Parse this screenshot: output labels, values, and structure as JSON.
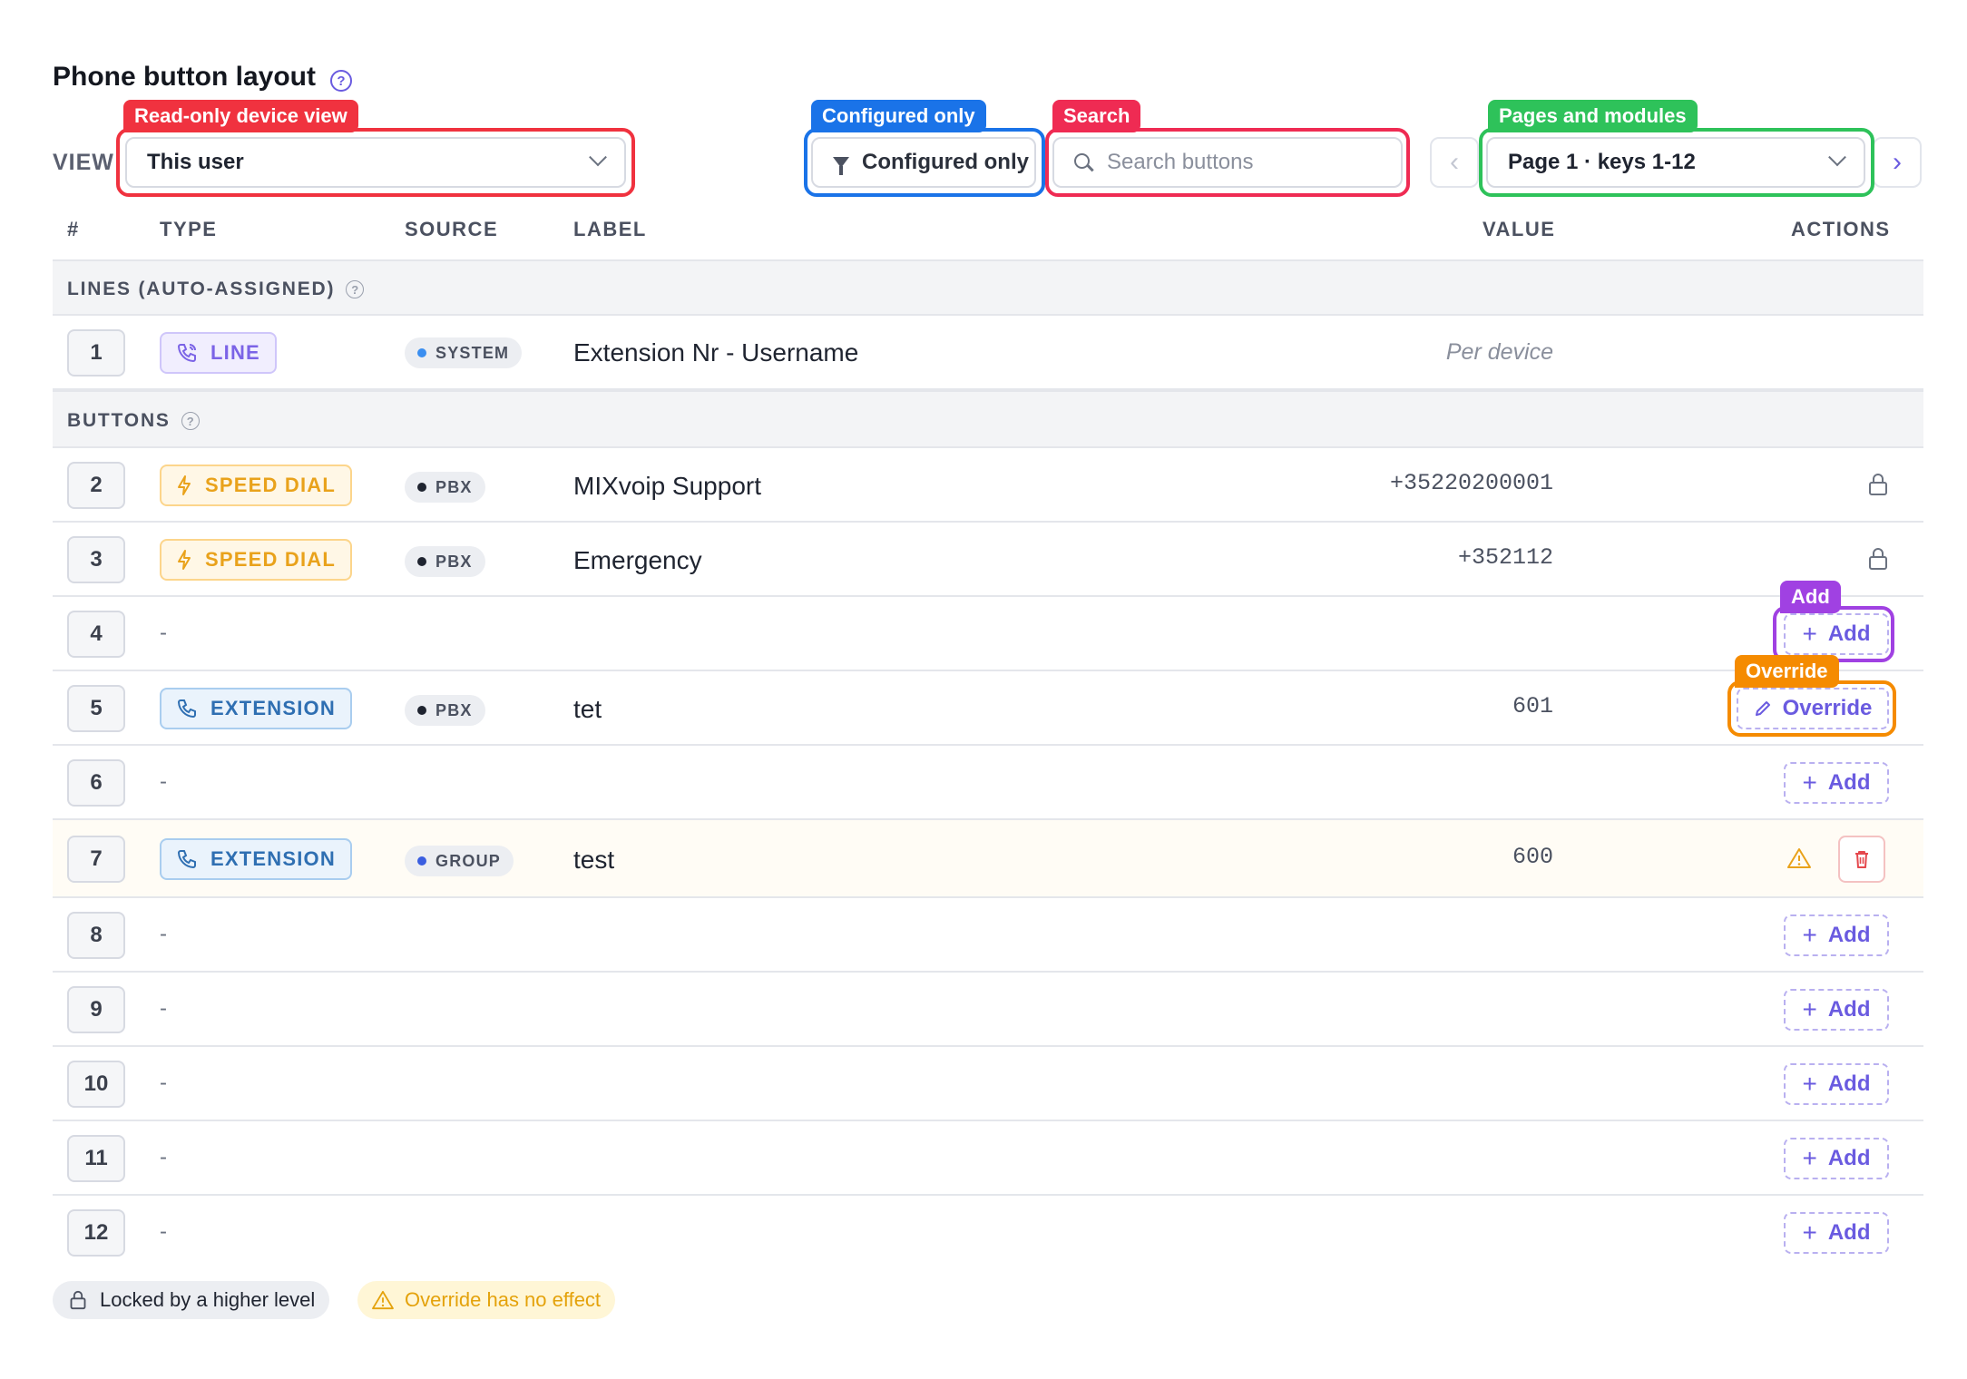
{
  "header": {
    "title": "Phone button layout",
    "help": "?"
  },
  "toolbar": {
    "view_label": "VIEW",
    "view_value": "This user",
    "filter_label": "Configured only",
    "search_placeholder": "Search buttons",
    "page_value": "Page 1 · keys 1-12",
    "prev": "‹",
    "next": "›"
  },
  "annotations": {
    "view": "Read-only device view",
    "filter": "Configured only",
    "search": "Search",
    "pages": "Pages and modules",
    "add": "Add",
    "override": "Override"
  },
  "columns": {
    "num": "#",
    "type": "TYPE",
    "source": "SOURCE",
    "label": "LABEL",
    "value": "VALUE",
    "actions": "ACTIONS"
  },
  "groups": {
    "lines": "LINES (AUTO-ASSIGNED)",
    "buttons": "BUTTONS"
  },
  "rows": [
    {
      "num": "1",
      "type": "LINE",
      "source": "SYSTEM",
      "label": "Extension Nr - Username",
      "value": "Per device"
    },
    {
      "num": "2",
      "type": "SPEED DIAL",
      "source": "PBX",
      "label": "MIXvoip Support",
      "value": "+35220200001"
    },
    {
      "num": "3",
      "type": "SPEED DIAL",
      "source": "PBX",
      "label": "Emergency",
      "value": "+352112"
    },
    {
      "num": "4",
      "type": "-",
      "action": "Add"
    },
    {
      "num": "5",
      "type": "EXTENSION",
      "source": "PBX",
      "label": "tet",
      "value": "601",
      "action": "Override"
    },
    {
      "num": "6",
      "type": "-",
      "action": "Add"
    },
    {
      "num": "7",
      "type": "EXTENSION",
      "source": "GROUP",
      "label": "test",
      "value": "600"
    },
    {
      "num": "8",
      "type": "-",
      "action": "Add"
    },
    {
      "num": "9",
      "type": "-",
      "action": "Add"
    },
    {
      "num": "10",
      "type": "-",
      "action": "Add"
    },
    {
      "num": "11",
      "type": "-",
      "action": "Add"
    },
    {
      "num": "12",
      "type": "-",
      "action": "Add"
    }
  ],
  "legend": {
    "locked": "Locked by a higher level",
    "warning": "Override has no effect"
  },
  "colors": {
    "accent": "#6a5be0",
    "annotation_red": "#f0323f",
    "annotation_blue": "#1a73e8",
    "annotation_crimson": "#ef2b53",
    "annotation_green": "#2ec25a",
    "annotation_purple": "#a041e2",
    "annotation_orange": "#f58b00"
  }
}
